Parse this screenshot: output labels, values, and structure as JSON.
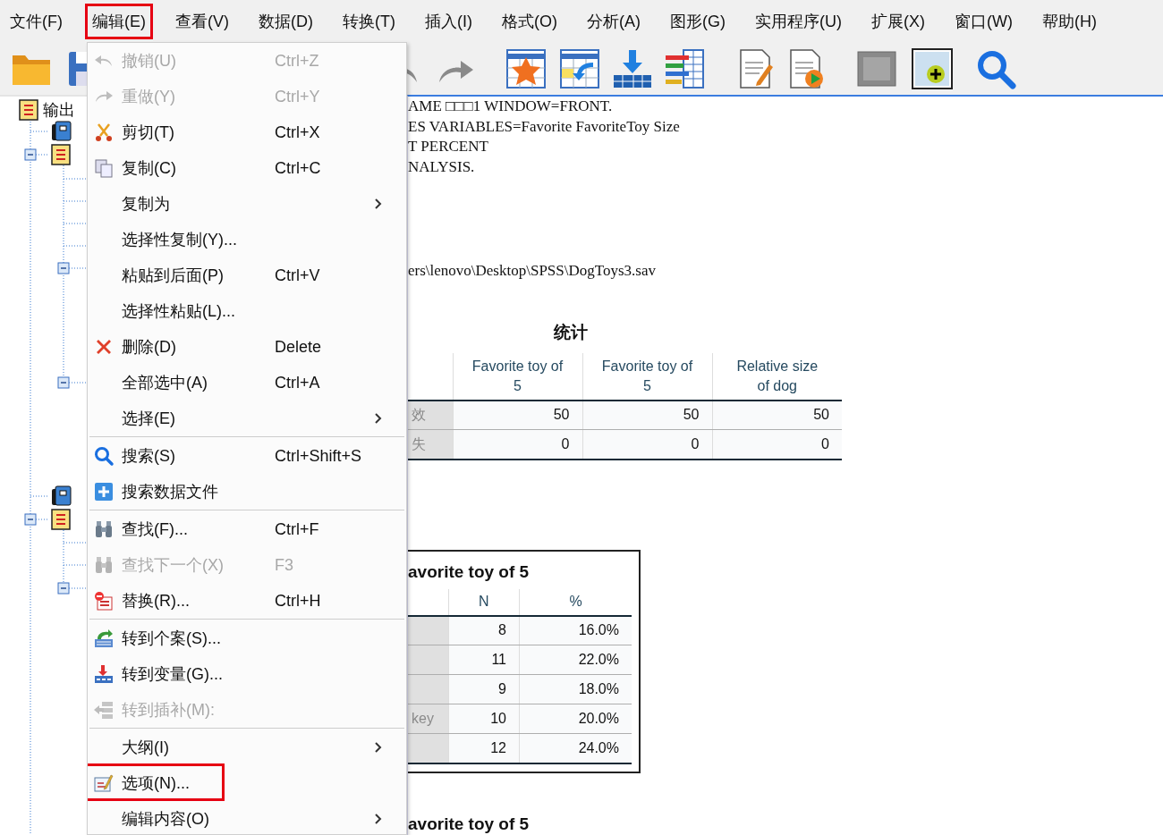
{
  "menubar": [
    {
      "label": "文件(F)",
      "annotated": false
    },
    {
      "label": "编辑(E)",
      "annotated": true
    },
    {
      "label": "查看(V)",
      "annotated": false
    },
    {
      "label": "数据(D)",
      "annotated": false
    },
    {
      "label": "转换(T)",
      "annotated": false
    },
    {
      "label": "插入(I)",
      "annotated": false
    },
    {
      "label": "格式(O)",
      "annotated": false
    },
    {
      "label": "分析(A)",
      "annotated": false
    },
    {
      "label": "图形(G)",
      "annotated": false
    },
    {
      "label": "实用程序(U)",
      "annotated": false
    },
    {
      "label": "扩展(X)",
      "annotated": false
    },
    {
      "label": "窗口(W)",
      "annotated": false
    },
    {
      "label": "帮助(H)",
      "annotated": false
    }
  ],
  "edit_menu": {
    "items": [
      {
        "kind": "item",
        "label": "撤销(U)",
        "shortcut": "Ctrl+Z",
        "disabled": true,
        "submenu": false,
        "annotated": false
      },
      {
        "kind": "item",
        "label": "重做(Y)",
        "shortcut": "Ctrl+Y",
        "disabled": true,
        "submenu": false,
        "annotated": false
      },
      {
        "kind": "item",
        "label": "剪切(T)",
        "shortcut": "Ctrl+X",
        "disabled": false,
        "submenu": false,
        "annotated": false
      },
      {
        "kind": "item",
        "label": "复制(C)",
        "shortcut": "Ctrl+C",
        "disabled": false,
        "submenu": false,
        "annotated": false
      },
      {
        "kind": "item",
        "label": "复制为",
        "disabled": false,
        "submenu": true,
        "annotated": false
      },
      {
        "kind": "item",
        "label": "选择性复制(Y)...",
        "disabled": false,
        "submenu": false,
        "annotated": false
      },
      {
        "kind": "item",
        "label": "粘贴到后面(P)",
        "shortcut": "Ctrl+V",
        "disabled": false,
        "submenu": false,
        "annotated": false
      },
      {
        "kind": "item",
        "label": "选择性粘贴(L)...",
        "disabled": false,
        "submenu": false,
        "annotated": false
      },
      {
        "kind": "item",
        "label": "删除(D)",
        "shortcut": "Delete",
        "disabled": false,
        "submenu": false,
        "annotated": false
      },
      {
        "kind": "item",
        "label": "全部选中(A)",
        "shortcut": "Ctrl+A",
        "disabled": false,
        "submenu": false,
        "annotated": false
      },
      {
        "kind": "item",
        "label": "选择(E)",
        "disabled": false,
        "submenu": true,
        "annotated": false
      },
      {
        "kind": "separator"
      },
      {
        "kind": "item",
        "label": "搜索(S)",
        "shortcut": "Ctrl+Shift+S",
        "disabled": false,
        "submenu": false,
        "annotated": false
      },
      {
        "kind": "item",
        "label": "搜索数据文件",
        "disabled": false,
        "submenu": false,
        "annotated": false
      },
      {
        "kind": "separator"
      },
      {
        "kind": "item",
        "label": "查找(F)...",
        "shortcut": "Ctrl+F",
        "disabled": false,
        "submenu": false,
        "annotated": false
      },
      {
        "kind": "item",
        "label": "查找下一个(X)",
        "shortcut": "F3",
        "disabled": true,
        "submenu": false,
        "annotated": false
      },
      {
        "kind": "item",
        "label": "替换(R)...",
        "shortcut": "Ctrl+H",
        "disabled": false,
        "submenu": false,
        "annotated": false
      },
      {
        "kind": "separator"
      },
      {
        "kind": "item",
        "label": "转到个案(S)...",
        "disabled": false,
        "submenu": false,
        "annotated": false
      },
      {
        "kind": "item",
        "label": "转到变量(G)...",
        "disabled": false,
        "submenu": false,
        "annotated": false
      },
      {
        "kind": "item",
        "label": "转到插补(M):",
        "disabled": true,
        "submenu": false,
        "annotated": false
      },
      {
        "kind": "separator"
      },
      {
        "kind": "item",
        "label": "大纲(I)",
        "disabled": false,
        "submenu": true,
        "annotated": false
      },
      {
        "kind": "item",
        "label": "选项(N)...",
        "disabled": false,
        "submenu": false,
        "annotated": true
      },
      {
        "kind": "item",
        "label": "编辑内容(O)",
        "disabled": false,
        "submenu": true,
        "annotated": false
      }
    ]
  },
  "outline": {
    "label": "输出",
    "children": [
      {
        "kind": "log"
      },
      {
        "kind": "output",
        "expanded": true,
        "children": [
          {
            "kind": "leaf"
          },
          {
            "kind": "leaf"
          },
          {
            "kind": "leaf"
          },
          {
            "kind": "leaf"
          },
          {
            "kind": "leaf",
            "expanded": true
          },
          {
            "kind": "leaf",
            "expanded": true
          }
        ]
      },
      {
        "kind": "log"
      },
      {
        "kind": "output",
        "expanded": true,
        "children": [
          {
            "kind": "leaf"
          },
          {
            "kind": "leaf"
          },
          {
            "kind": "leaf",
            "expanded": true
          }
        ]
      }
    ]
  },
  "log_lines": [
    "AME □□□1 WINDOW=FRONT.",
    "ES VARIABLES=Favorite FavoriteToy Size",
    "T PERCENT",
    "NALYSIS."
  ],
  "file_path": "ers\\lenovo\\Desktop\\SPSS\\DogToys3.sav",
  "statistics": {
    "title": "统计",
    "columns": [
      "Favorite toy of 5",
      "Favorite toy of 5",
      "Relative size of dog"
    ],
    "rows": [
      {
        "label": "效",
        "values": [
          "50",
          "50",
          "50"
        ]
      },
      {
        "label": "失",
        "values": [
          "0",
          "0",
          "0"
        ]
      }
    ]
  },
  "frequency_table": {
    "title": "avorite toy of 5",
    "columns": [
      "N",
      "%"
    ],
    "rows": [
      {
        "values": [
          "8",
          "16.0%"
        ]
      },
      {
        "values": [
          "11",
          "22.0%"
        ]
      },
      {
        "values": [
          "9",
          "18.0%"
        ]
      },
      {
        "label": "key",
        "values": [
          "10",
          "20.0%"
        ]
      },
      {
        "values": [
          "12",
          "24.0%"
        ]
      }
    ]
  },
  "next_table": {
    "title": "avorite toy of 5"
  }
}
